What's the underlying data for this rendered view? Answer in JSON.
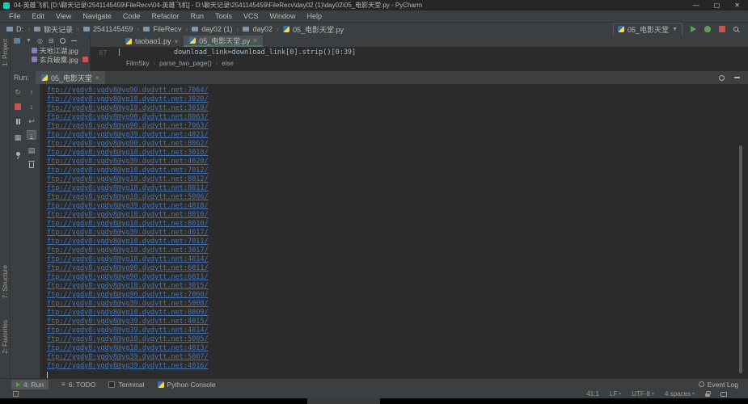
{
  "window": {
    "title": "04-英雄飞机 [D:\\聊天记录\\2541145459\\FileRecv\\04-英雄飞机] - D:\\聊天记录\\2541145459\\FileRecv\\day02 (1)\\day02\\05_电影天堂.py - PyCharm",
    "minimize": "—",
    "maximize": "▢",
    "close": "✕"
  },
  "menu": {
    "items": [
      "File",
      "Edit",
      "View",
      "Navigate",
      "Code",
      "Refactor",
      "Run",
      "Tools",
      "VCS",
      "Window",
      "Help"
    ]
  },
  "breadcrumbs": {
    "dirs": [
      "D:",
      "聊天记录",
      "2541145459",
      "FileRecv",
      "day02 (1)",
      "day02"
    ],
    "file": "05_电影天堂.py"
  },
  "run_config": {
    "name": "05_电影天堂"
  },
  "side_labels": {
    "project": "1: Project",
    "structure": "7: Structure",
    "favorites": "2: Favorites"
  },
  "project_panel": {
    "files": [
      "天地江湖.jpg",
      "玄兵破魔.jpg"
    ]
  },
  "editor": {
    "tabs": [
      {
        "label": "taobao1.py"
      },
      {
        "label": "05_电影天堂.py"
      }
    ],
    "close_glyph": "×",
    "line_number": "67",
    "code": "download_link=download_link[0].strip()[0:39]",
    "breadcrumb": [
      "FilmSky",
      "parse_two_page()",
      "else"
    ]
  },
  "run_panel": {
    "label": "Run:",
    "tab": "05_电影天堂",
    "tab_close": "×"
  },
  "console": {
    "links": [
      "ftp://ygdy8:ygdy8@yg90.dydytt.net:7064/",
      "ftp://ygdy8:ygdy8@yg18.dydytt.net:3020/",
      "ftp://ygdy8:ygdy8@yg18.dydytt.net:3019/",
      "ftp://ygdy8:ygdy8@yg90.dydytt.net:8063/",
      "ftp://ygdy8:ygdy8@yg90.dydytt.net:7063/",
      "ftp://ygdy8:ygdy8@yg39.dydytt.net:4021/",
      "ftp://ygdy8:ygdy8@yg90.dydytt.net:8062/",
      "ftp://ygdy8:ygdy8@yg18.dydytt.net:3018/",
      "ftp://ygdy8:ygdy8@yg39.dydytt.net:4020/",
      "ftp://ygdy8:ygdy8@yg18.dydytt.net:7012/",
      "ftp://ygdy8:ygdy8@yg18.dydytt.net:8012/",
      "ftp://ygdy8:ygdy8@yg18.dydytt.net:8011/",
      "ftp://ygdy8:ygdy8@yg18.dydytt.net:5006/",
      "ftp://ygdy8:ygdy8@yg39.dydytt.net:4018/",
      "ftp://ygdy8:ygdy8@yg18.dydytt.net:8010/",
      "ftp://ygdy8:ygdy8@yg18.dydytt.net:8010/",
      "ftp://ygdy8:ygdy8@yg39.dydytt.net:4017/",
      "ftp://ygdy8:ygdy8@yg18.dydytt.net:7011/",
      "ftp://ygdy8:ygdy8@yg18.dydytt.net:3017/",
      "ftp://ygdy8:ygdy8@yg18.dydytt.net:4014/",
      "ftp://ygdy8:ygdy8@yg90.dydytt.net:6011/",
      "ftp://ygdy8:ygdy8@yg90.dydytt.net:6011/",
      "ftp://ygdy8:ygdy8@yg18.dydytt.net:3015/",
      "ftp://ygdy8:ygdy8@yg90.dydytt.net:7060/",
      "ftp://ygdy8:ygdy8@yg39.dydytt.net:5008/",
      "ftp://ygdy8:ygdy8@yg18.dydytt.net:8009/",
      "ftp://ygdy8:ygdy8@yg39.dydytt.net:4015/",
      "ftp://ygdy8:ygdy8@yg39.dydytt.net:4014/",
      "ftp://ygdy8:ygdy8@yg18.dydytt.net:5005/",
      "ftp://ygdy8:ygdy8@yg18.dydytt.net:4013/",
      "ftp://ygdy8:ygdy8@yg39.dydytt.net:5007/",
      "ftp://ygdy8:ygdy8@yg39.dydytt.net:4016/"
    ]
  },
  "tool_buttons": {
    "run": "4: Run",
    "todo": "6: TODO",
    "terminal": "Terminal",
    "python_console": "Python Console",
    "event_log": "Event Log"
  },
  "status_bar": {
    "position": "41:1",
    "line_sep": "LF",
    "encoding": "UTF-8",
    "indent": "4 spaces"
  },
  "colors": {
    "link_blue": "#4576b9",
    "active_tab_underline": "#3d7a68",
    "run_green": "#5f9e55",
    "stop_red": "#c75450",
    "chrome": "#3c3f41",
    "editor_bg": "#2b2b2b"
  }
}
